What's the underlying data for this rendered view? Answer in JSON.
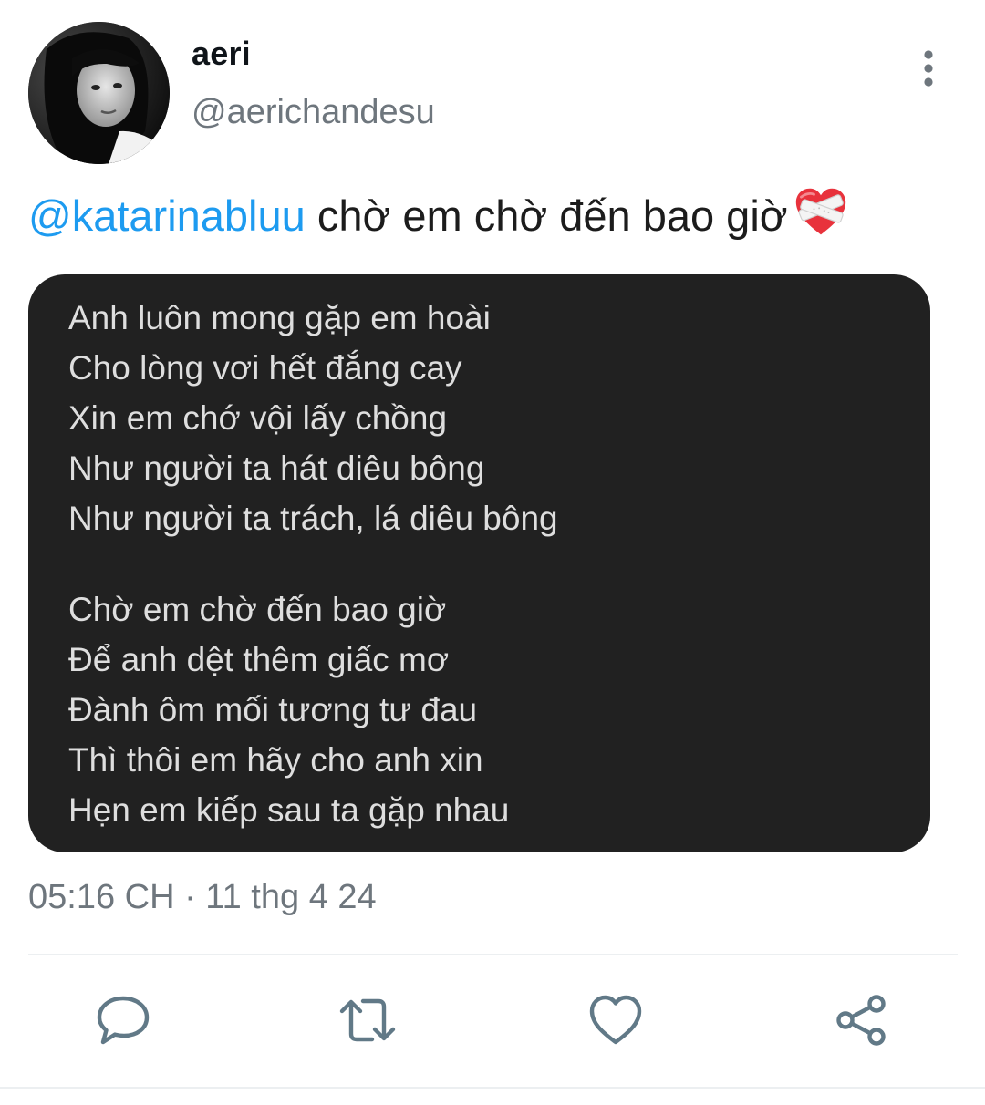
{
  "tweet": {
    "author": {
      "display_name": "aeri",
      "handle": "@aerichandesu"
    },
    "text": {
      "mention": "@katarinabluu",
      "body": "chờ em chờ đến bao giờ"
    },
    "emoji": "mending-heart",
    "lyrics": {
      "stanzas": [
        [
          "Anh luôn mong gặp em hoài",
          "Cho lòng vơi hết đắng cay",
          "Xin em chớ vội lấy chồng",
          "Như người ta hát diêu bông",
          "Như người ta trách, lá diêu bông"
        ],
        [
          "Chờ em chờ đến bao giờ",
          "Để anh dệt thêm giấc mơ",
          "Đành ôm mối tương tư đau",
          "Thì thôi em hãy cho anh xin",
          "Hẹn em kiếp sau ta gặp nhau"
        ]
      ]
    },
    "timestamp": "05:16 CH · 11 thg 4 24",
    "actions": [
      "reply-icon",
      "retweet-icon",
      "like-icon",
      "share-icon"
    ],
    "colors": {
      "mention": "#1d9bf0",
      "secondary_text": "#6e767d",
      "card_bg": "#212121",
      "card_text": "#dedede",
      "icon": "#617987"
    }
  }
}
